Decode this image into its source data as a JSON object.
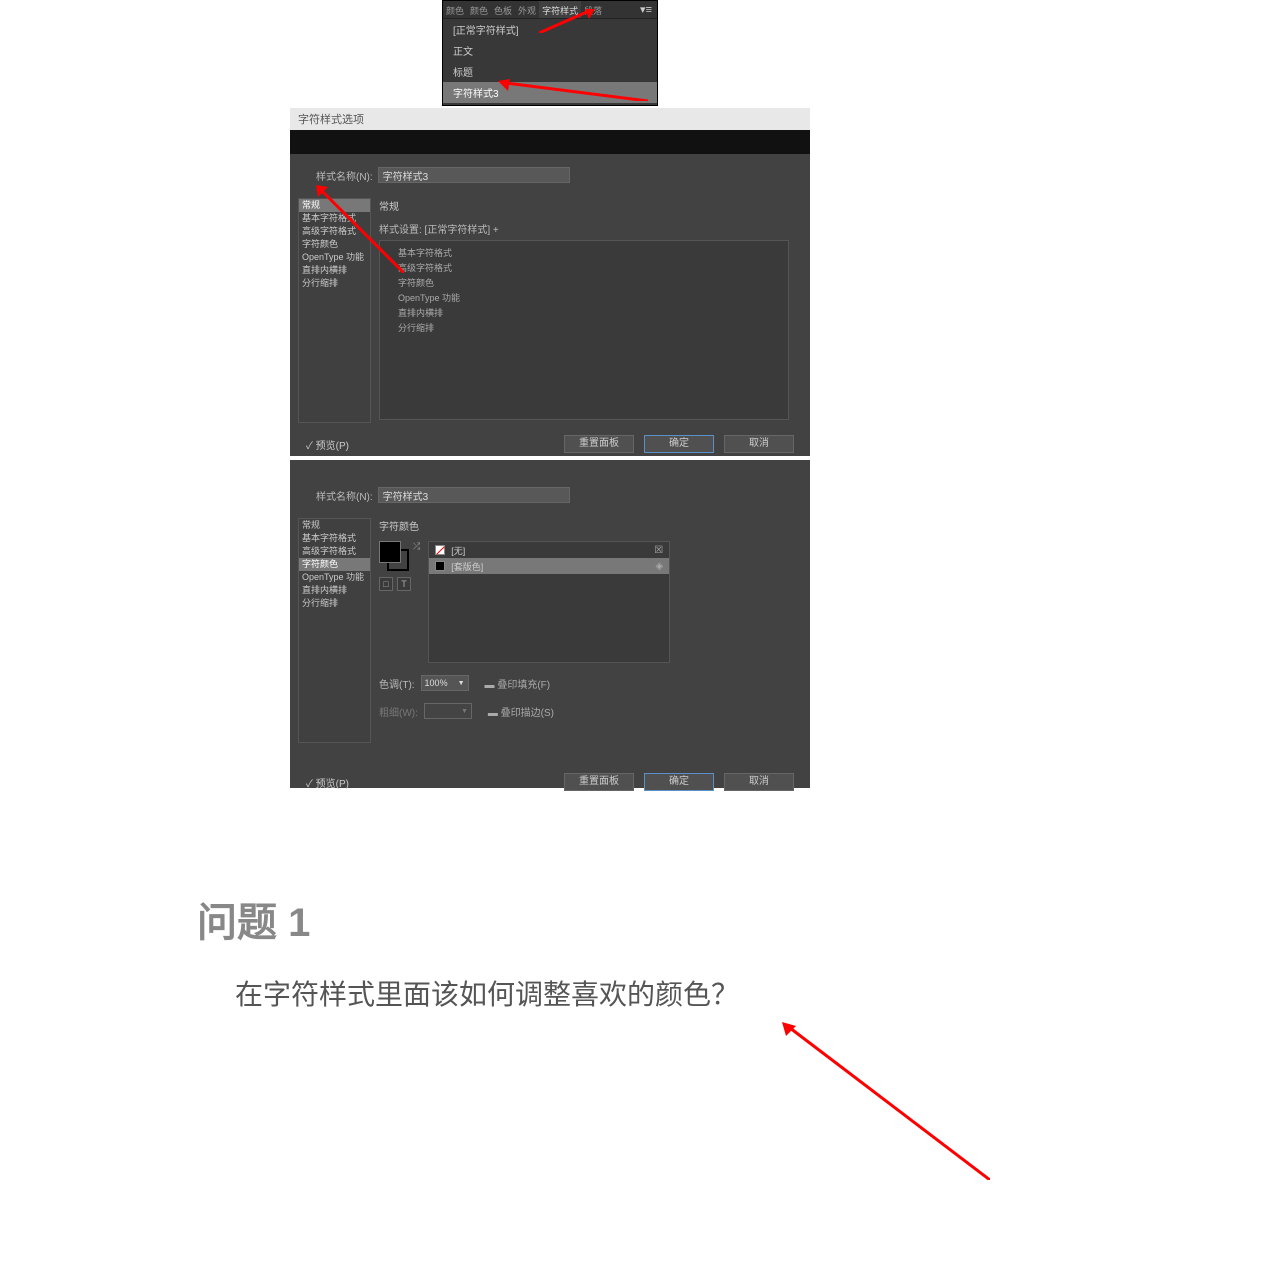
{
  "panel": {
    "tabs": [
      "颜色",
      "颜色",
      "色板",
      "外观",
      "字符样式",
      "段落"
    ],
    "menu_icon": "▾≡",
    "styles": [
      "[正常字符样式]",
      "正文",
      "标题",
      "字符样式3"
    ]
  },
  "dialog1": {
    "title": "字符样式选项",
    "name_label": "样式名称(N):",
    "name_value": "字符样式3",
    "categories": [
      "常规",
      "基本字符格式",
      "高级字符格式",
      "字符颜色",
      "OpenType 功能",
      "直排内横排",
      "分行缩排"
    ],
    "active_category": "常规",
    "section_title": "常规",
    "settings_label": "样式设置: [正常字符样式] +",
    "settings_items": [
      "基本字符格式",
      "高级字符格式",
      "字符颜色",
      "OpenType 功能",
      "直排内横排",
      "分行缩排"
    ],
    "preview": "✓ 预览(P)",
    "btn_reset": "重置面板",
    "btn_ok": "确定",
    "btn_cancel": "取消"
  },
  "dialog2": {
    "name_label": "样式名称(N):",
    "name_value": "字符样式3",
    "categories": [
      "常规",
      "基本字符格式",
      "高级字符格式",
      "字符颜色",
      "OpenType 功能",
      "直排内横排",
      "分行缩排"
    ],
    "active_category": "字符颜色",
    "section_title": "字符颜色",
    "color_list": [
      {
        "name": "[无]",
        "chip": "none"
      },
      {
        "name": "[套版色]",
        "chip": "reg"
      }
    ],
    "tint_label": "色调(T):",
    "tint_value": "100%",
    "overprint_fill": "叠印填充(F)",
    "weight_label": "粗细(W):",
    "overprint_stroke": "叠印描边(S)",
    "preview": "✓ 预览(P)",
    "btn_reset": "重置面板",
    "btn_ok": "确定",
    "btn_cancel": "取消"
  },
  "question": {
    "title": "问题 1",
    "body": "在字符样式里面该如何调整喜欢的颜色？"
  }
}
